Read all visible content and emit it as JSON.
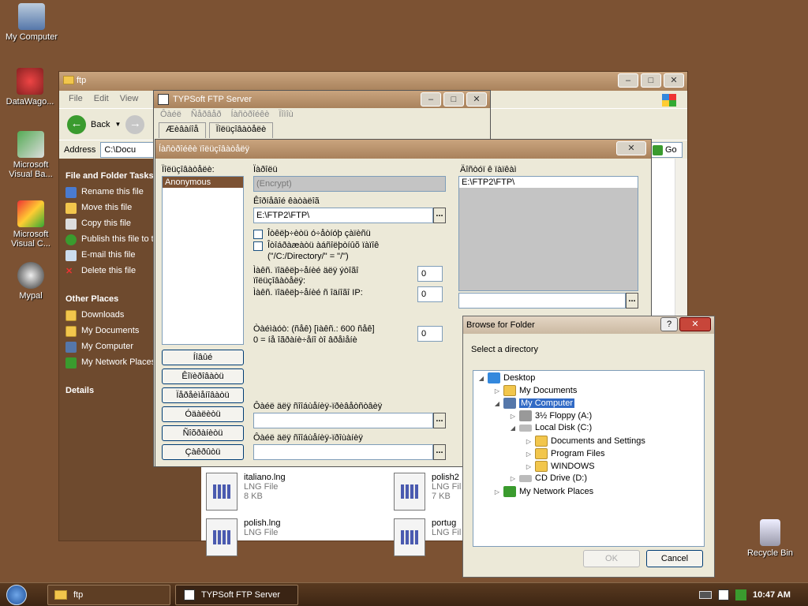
{
  "desktop": {
    "icons": [
      {
        "label": "My Computer"
      },
      {
        "label": "DataWago..."
      },
      {
        "label": "Microsoft Visual Ba..."
      },
      {
        "label": "Microsoft Visual C..."
      },
      {
        "label": "Mypal"
      },
      {
        "label": "Recycle Bin"
      }
    ]
  },
  "explorer": {
    "title": "ftp",
    "menu": [
      "File",
      "Edit",
      "View"
    ],
    "back_label": "Back",
    "address_label": "Address",
    "address_value": "C:\\Docu",
    "go_label": "Go",
    "task_pane": {
      "file_tasks_header": "File and Folder Tasks",
      "file_tasks": [
        "Rename this file",
        "Move this file",
        "Copy this file",
        "Publish this file to the Web",
        "E-mail this file",
        "Delete this file"
      ],
      "other_places_header": "Other Places",
      "other_places": [
        "Downloads",
        "My Documents",
        "My Computer",
        "My Network Places"
      ],
      "details_header": "Details"
    },
    "files": [
      {
        "name": "italiano.lng",
        "type": "LNG File",
        "size": "8 KB"
      },
      {
        "name": "polish2",
        "type": "LNG Fil",
        "size": "7 KB"
      },
      {
        "name": "polish.lng",
        "type": "LNG File",
        "size": ""
      },
      {
        "name": "portug",
        "type": "LNG Fil",
        "size": ""
      }
    ]
  },
  "typsoft": {
    "title": "TYPSoft FTP Server",
    "menu": [
      "Ôàéë",
      "Ñåðâåð",
      "Íàñòðîéêè",
      "Ïîìîù"
    ],
    "tabs": [
      "Æèâàíîå",
      "Ïîëüçîâàòåëè"
    ]
  },
  "settings": {
    "title": "Íàñòðîéêè ïîëüçîâàòåëÿ",
    "users_label": "Ïîëüçîâàòåëè:",
    "users": [
      "Anonymous"
    ],
    "password_label": "Ïàðîëü",
    "password_value": "(Encrypt)",
    "home_dir_label": "Êîðíåâîé êàòàëîã",
    "home_dir_value": "E:\\FTP2\\FTP\\",
    "chk1_label": "Îòêëþ÷èòü ó÷åòíóþ çàïèñü",
    "chk2_label": "Îòîáðàæàòü àáñîëþòíûõ ïàïîê",
    "chk2_hint": "(\"/C:/Directory/\" = \"/\")",
    "max_users_label": "Ìàêñ. ïîäêëþ÷åíèé äëÿ ýòîãî ïîëüçîâàòåëÿ:",
    "max_users_value": "0",
    "max_ip_label": "Ìàêñ. ïîäêëþ÷åíèé ñ îäíîãî IP:",
    "max_ip_value": "0",
    "timeout_label": "Òàéìàóò: (ñåê) [ìàêñ.: 600 ñåê]",
    "timeout_hint": "0 = íå îãðàíè÷åíî òî âðåìåíè",
    "timeout_value": "0",
    "access_label": "Äîñòóï ê ïàïêàì",
    "access_list": [
      "E:\\FTP2\\FTP\\"
    ],
    "welcome_label": "Ôàéë äëÿ ñîîáùåíèÿ-ïðèâåòñòâèÿ",
    "goodbye_label": "Ôàéë äëÿ ñîîáùåíèÿ-ïðîùàíèÿ",
    "buttons": [
      "Íîâûé",
      "Êîïèðîâàòü",
      "Ïåðåèìåíîâàòü",
      "Óäàëèòü",
      "Ñîõðàíèòü",
      "Çàêðûòü"
    ],
    "dots": "..."
  },
  "browse": {
    "title": "Browse for Folder",
    "prompt": "Select a directory",
    "tree": [
      {
        "label": "Desktop",
        "level": 0,
        "toggle": "▲"
      },
      {
        "label": "My Documents",
        "level": 1,
        "toggle": "▷"
      },
      {
        "label": "My Computer",
        "level": 1,
        "toggle": "◢",
        "selected": true
      },
      {
        "label": "3½ Floppy (A:)",
        "level": 2,
        "toggle": "▷"
      },
      {
        "label": "Local Disk (C:)",
        "level": 2,
        "toggle": "◢"
      },
      {
        "label": "Documents and Settings",
        "level": 3,
        "toggle": "▷"
      },
      {
        "label": "Program Files",
        "level": 3,
        "toggle": "▷"
      },
      {
        "label": "WINDOWS",
        "level": 3,
        "toggle": "▷"
      },
      {
        "label": "CD Drive (D:)",
        "level": 2,
        "toggle": "▷"
      },
      {
        "label": "My Network Places",
        "level": 1,
        "toggle": "▷"
      }
    ],
    "ok_label": "OK",
    "cancel_label": "Cancel",
    "help_label": "?",
    "close_label": "✕"
  },
  "taskbar": {
    "items": [
      {
        "label": "ftp",
        "active": false
      },
      {
        "label": "TYPSoft FTP Server",
        "active": true
      }
    ],
    "clock": "10:47 AM"
  },
  "colors": {
    "desktop": "#7c5233",
    "title_bar": "#a9825c",
    "selection": "#316ac5"
  }
}
